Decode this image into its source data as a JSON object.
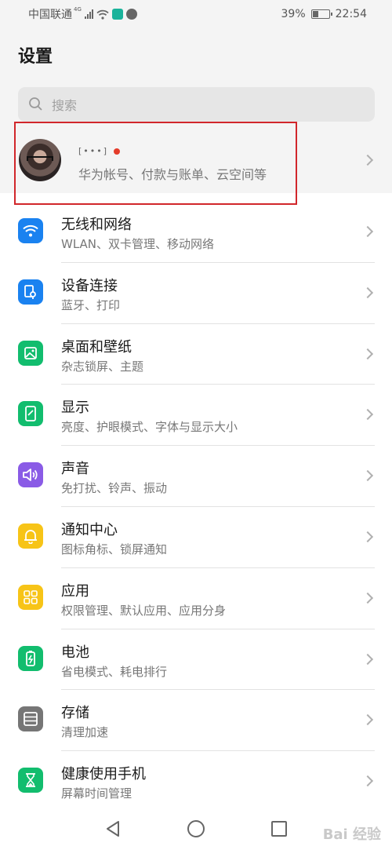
{
  "status": {
    "carrier": "中国联通",
    "network": "4G",
    "battery_percent": "39%",
    "battery_level": 0.39,
    "time": "22:54"
  },
  "page": {
    "title": "设置"
  },
  "search": {
    "placeholder": "搜索"
  },
  "account": {
    "name": "[•••]",
    "subtitle": "华为帐号、付款与账单、云空间等"
  },
  "settings": [
    {
      "title": "无线和网络",
      "subtitle": "WLAN、双卡管理、移动网络",
      "color": "#1a82f0",
      "icon": "wifi-icon"
    },
    {
      "title": "设备连接",
      "subtitle": "蓝牙、打印",
      "color": "#1a82f0",
      "icon": "device-connection-icon"
    },
    {
      "title": "桌面和壁纸",
      "subtitle": "杂志锁屏、主题",
      "color": "#12bd6e",
      "icon": "wallpaper-icon"
    },
    {
      "title": "显示",
      "subtitle": "亮度、护眼模式、字体与显示大小",
      "color": "#12bd6e",
      "icon": "display-icon"
    },
    {
      "title": "声音",
      "subtitle": "免打扰、铃声、振动",
      "color": "#8a5be6",
      "icon": "sound-icon"
    },
    {
      "title": "通知中心",
      "subtitle": "图标角标、锁屏通知",
      "color": "#f7c417",
      "icon": "notification-bell-icon"
    },
    {
      "title": "应用",
      "subtitle": "权限管理、默认应用、应用分身",
      "color": "#f7c417",
      "icon": "apps-grid-icon"
    },
    {
      "title": "电池",
      "subtitle": "省电模式、耗电排行",
      "color": "#12bd6e",
      "icon": "battery-icon"
    },
    {
      "title": "存储",
      "subtitle": "清理加速",
      "color": "#767676",
      "icon": "storage-icon"
    },
    {
      "title": "健康使用手机",
      "subtitle": "屏幕时间管理",
      "color": "#12bd6e",
      "icon": "hourglass-icon"
    }
  ],
  "watermark": "Bai 经验"
}
